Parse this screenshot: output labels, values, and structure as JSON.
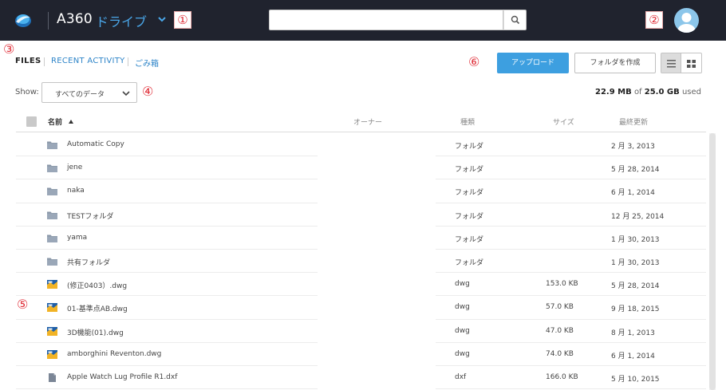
{
  "header": {
    "app_name": "A360",
    "drive_label": "ドライブ",
    "search": {
      "placeholder": ""
    }
  },
  "callouts": {
    "c1": "①",
    "c2": "②",
    "c3": "③",
    "c4": "④",
    "c5": "⑤",
    "c6": "⑥"
  },
  "nav": {
    "files": "FILES",
    "recent": "RECENT ACTIVITY",
    "trash": "ごみ箱"
  },
  "toolbar": {
    "upload": "アップロード",
    "new_folder": "フォルダを作成"
  },
  "filter": {
    "show_label": "Show:",
    "selected": "すべてのデータ"
  },
  "storage": {
    "used": "22.9 MB",
    "of": "of",
    "total": "25.0 GB",
    "used_suffix": "used"
  },
  "table": {
    "columns": {
      "name": "名前",
      "owner": "オーナー",
      "type": "種類",
      "size": "サイズ",
      "modified": "最終更新"
    },
    "rows": [
      {
        "icon": "folder-icon",
        "name": "Automatic Copy",
        "type": "フォルダ",
        "size": "",
        "date": "2 月 3, 2013"
      },
      {
        "icon": "folder-icon",
        "name": "jene",
        "type": "フォルダ",
        "size": "",
        "date": "5 月 28, 2014"
      },
      {
        "icon": "folder-icon",
        "name": "naka",
        "type": "フォルダ",
        "size": "",
        "date": "6 月 1, 2014"
      },
      {
        "icon": "folder-icon",
        "name": "TESTフォルダ",
        "type": "フォルダ",
        "size": "",
        "date": "12 月 25, 2014"
      },
      {
        "icon": "folder-icon",
        "name": "yama",
        "type": "フォルダ",
        "size": "",
        "date": "1 月 30, 2013"
      },
      {
        "icon": "folder-icon",
        "name": "共有フォルダ",
        "type": "フォルダ",
        "size": "",
        "date": "1 月 30, 2013"
      },
      {
        "icon": "dwg-file-icon",
        "name": "(修正0403）.dwg",
        "type": "dwg",
        "size": "153.0 KB",
        "date": "5 月 28, 2014"
      },
      {
        "icon": "dwg-file-icon",
        "name": "01-基準点AB.dwg",
        "type": "dwg",
        "size": "57.0 KB",
        "date": "9 月 18, 2015"
      },
      {
        "icon": "dwg-file-icon",
        "name": "3D機能(01).dwg",
        "type": "dwg",
        "size": "47.0 KB",
        "date": "8 月 1, 2013"
      },
      {
        "icon": "dwg-file-icon",
        "name": "amborghini Reventon.dwg",
        "type": "dwg",
        "size": "74.0 KB",
        "date": "6 月 1, 2014"
      },
      {
        "icon": "document-icon",
        "name": "Apple Watch Lug Profile R1.dxf",
        "type": "dxf",
        "size": "166.0 KB",
        "date": "5 月 10, 2015"
      }
    ]
  },
  "colors": {
    "topbar": "#20232e",
    "accent": "#3d9fe0",
    "link": "#2d84c8",
    "callout": "#e0303a"
  }
}
